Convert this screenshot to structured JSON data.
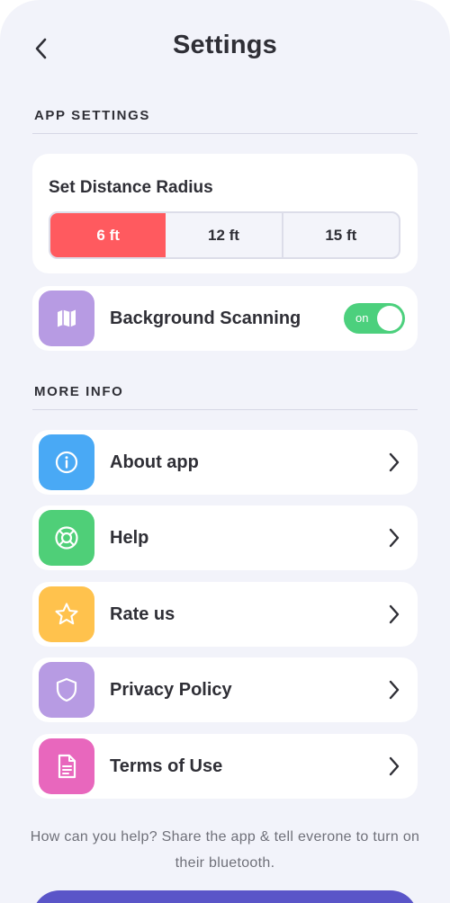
{
  "header": {
    "title": "Settings",
    "back_icon": "chevron-left-icon"
  },
  "app_settings": {
    "section_title": "APP SETTINGS",
    "distance": {
      "label": "Set Distance Radius",
      "options": [
        "6 ft",
        "12 ft",
        "15 ft"
      ],
      "selected": "6 ft"
    },
    "background_scanning": {
      "label": "Background Scanning",
      "icon": "map-icon",
      "toggle_text": "on",
      "enabled": true
    }
  },
  "more_info": {
    "section_title": "MORE INFO",
    "items": [
      {
        "label": "About app",
        "icon": "info-icon",
        "color": "#49a9f5"
      },
      {
        "label": "Help",
        "icon": "lifebuoy-icon",
        "color": "#4fcf78"
      },
      {
        "label": "Rate us",
        "icon": "star-icon",
        "color": "#ffc24d"
      },
      {
        "label": "Privacy Policy",
        "icon": "shield-icon",
        "color": "#b79be3"
      },
      {
        "label": "Terms of Use",
        "icon": "document-icon",
        "color": "#e867bd"
      }
    ]
  },
  "footer": {
    "text": "How can you help? Share the app & tell everone to turn on their bluetooth."
  },
  "colors": {
    "background": "#f2f3fa",
    "accent_red": "#ff5a5f",
    "toggle_green": "#4cd07d",
    "map_tile_purple": "#b79be3",
    "share_button": "#5a55c8"
  }
}
